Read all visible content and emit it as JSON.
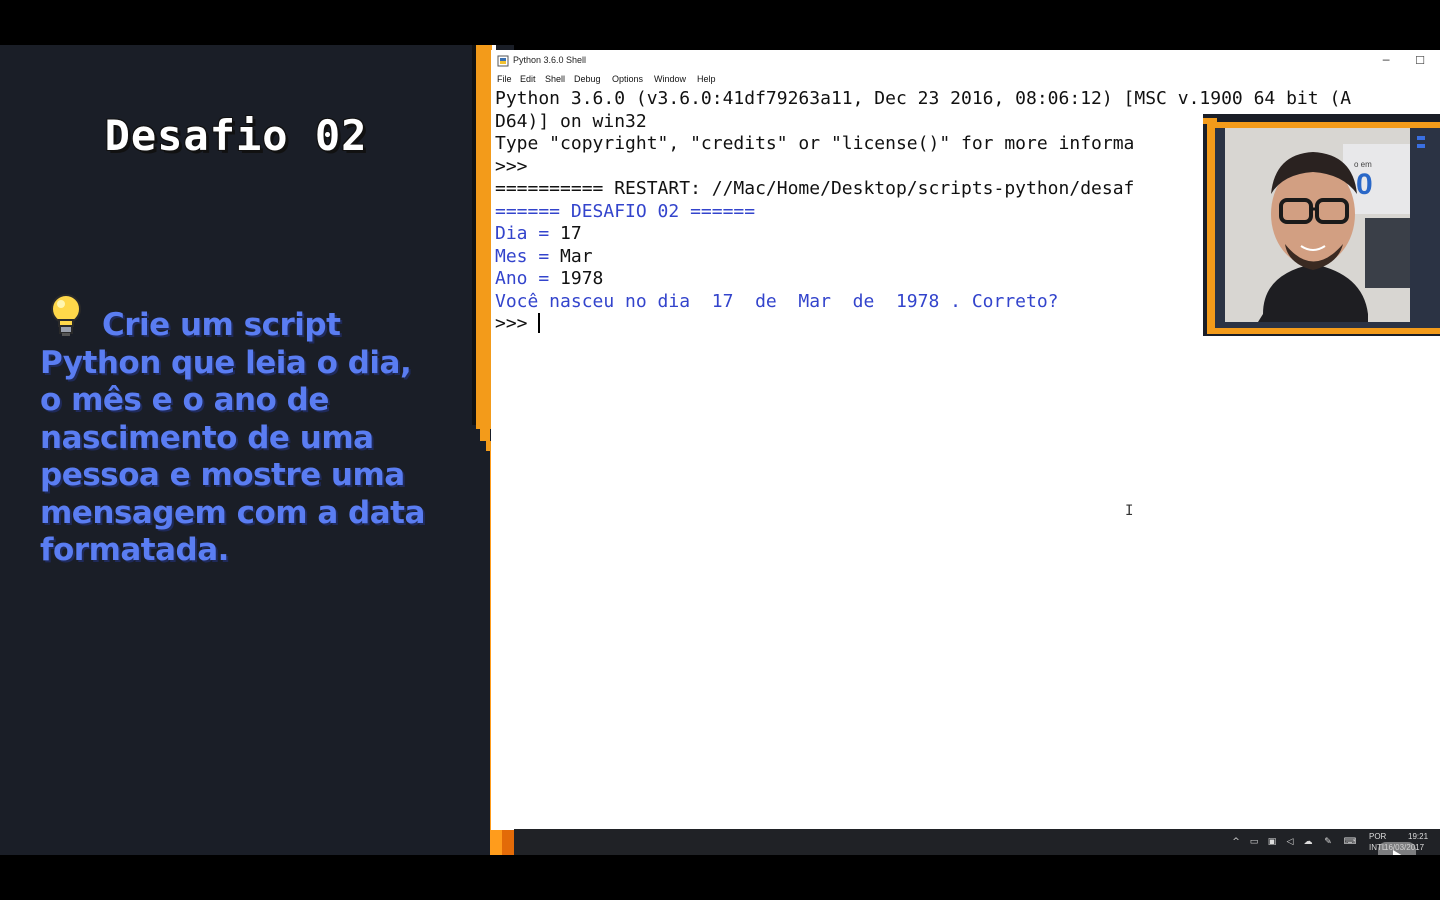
{
  "slide": {
    "title": "Desafio 02",
    "body": "Crie um script Python que leia o dia, o mês e o ano de nascimento de uma pessoa e mostre uma mensagem com a data formatada.",
    "icon": "lightbulb-icon"
  },
  "window": {
    "title": "Python 3.6.0 Shell",
    "minimize": "─",
    "maximize": "☐"
  },
  "menu": {
    "items": [
      "File",
      "Edit",
      "Shell",
      "Debug",
      "Options",
      "Window",
      "Help"
    ]
  },
  "shell": {
    "lines": [
      {
        "text": "Python 3.6.0 (v3.6.0:41df79263a11, Dec 23 2016, 08:06:12) [MSC v.1900 64 bit (A",
        "color": "black"
      },
      {
        "text": "D64)] on win32",
        "color": "black"
      },
      {
        "text": "Type \"copyright\", \"credits\" or \"license()\" for more informa",
        "color": "black"
      },
      {
        "text": ">>> ",
        "color": "black"
      },
      {
        "text": "========== RESTART: //Mac/Home/Desktop/scripts-python/desaf",
        "color": "black"
      },
      {
        "text": "====== DESAFIO 02 ======",
        "color": "blue"
      },
      {
        "prompt": "Dia = ",
        "value": "17"
      },
      {
        "prompt": "Mes = ",
        "value": "Mar"
      },
      {
        "prompt": "Ano = ",
        "value": "1978"
      },
      {
        "text": "Você nasceu no dia  17  de  Mar  de  1978 . Correto?",
        "color": "blue"
      },
      {
        "text": ">>> ",
        "color": "black",
        "cursor": true
      }
    ]
  },
  "taskbar": {
    "language": "POR",
    "layout": "INTL",
    "time": "19:21",
    "date": "16/03/2017"
  },
  "colors": {
    "slide_bg": "#1a1e27",
    "slide_text": "#5a7df2",
    "accent_orange": "#f39b1a",
    "shell_blue": "#3344cc"
  }
}
